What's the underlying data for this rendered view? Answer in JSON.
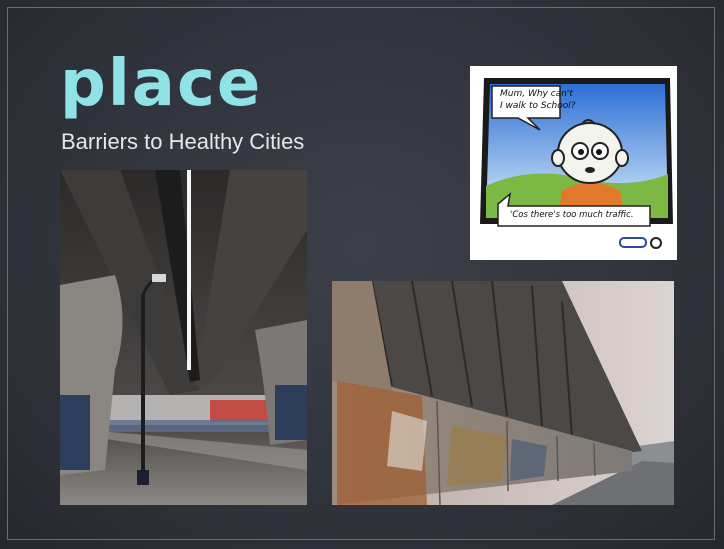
{
  "slide": {
    "logo": "place",
    "subtitle": "Barriers to Healthy Cities"
  },
  "cartoon": {
    "speech_top_line1": "Mum, Why can't",
    "speech_top_line2": "I walk to School?",
    "speech_bottom": "'Cos there's too much traffic.",
    "icon": "cycle-logo-icon"
  },
  "photos": {
    "underpass_icon": "underpass-photo",
    "wall_icon": "graffiti-wall-photo"
  },
  "colors": {
    "logo": "#8fe3e6",
    "background": "#32343d",
    "frame": "#6b6d75"
  }
}
